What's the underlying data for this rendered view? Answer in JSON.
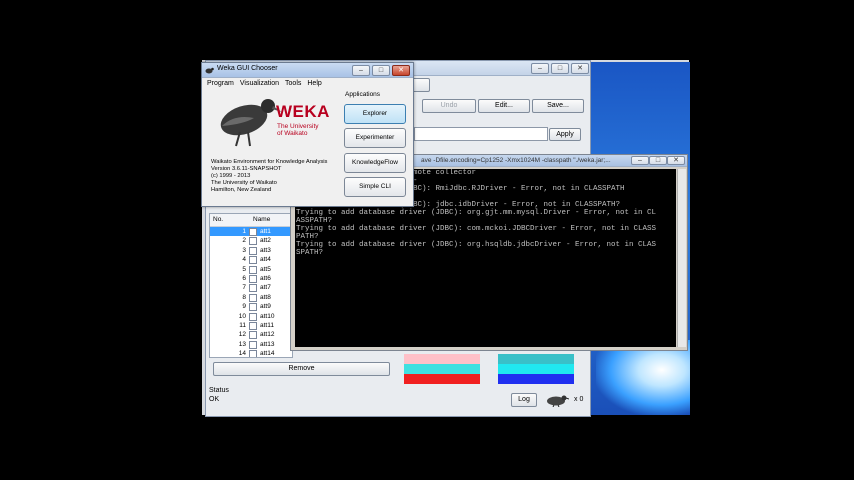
{
  "explorer": {
    "undo": "Undo",
    "edit": "Edit...",
    "save": "Save...",
    "apply": "Apply",
    "table_headers": {
      "no": "No.",
      "name": "Name"
    },
    "attributes": [
      {
        "no": "1",
        "name": "att1"
      },
      {
        "no": "2",
        "name": "att2"
      },
      {
        "no": "3",
        "name": "att3"
      },
      {
        "no": "4",
        "name": "att4"
      },
      {
        "no": "5",
        "name": "att5"
      },
      {
        "no": "6",
        "name": "att6"
      },
      {
        "no": "7",
        "name": "att7"
      },
      {
        "no": "8",
        "name": "att8"
      },
      {
        "no": "9",
        "name": "att9"
      },
      {
        "no": "10",
        "name": "att10"
      },
      {
        "no": "11",
        "name": "att11"
      },
      {
        "no": "12",
        "name": "att12"
      },
      {
        "no": "13",
        "name": "att13"
      },
      {
        "no": "14",
        "name": "att14"
      }
    ],
    "remove": "Remove",
    "status_label": "Status",
    "status_value": "OK",
    "log": "Log",
    "task_count": "x 0"
  },
  "chooser": {
    "title": "Weka GUI Chooser",
    "menu": [
      "Program",
      "Visualization",
      "Tools",
      "Help"
    ],
    "logo_word": "WEKA",
    "logo_sub1": "The University",
    "logo_sub2": "of Waikato",
    "info": [
      "Waikato Environment for Knowledge Analysis",
      "Version 3.6.11-SNAPSHOT",
      "(c) 1999 - 2013",
      "The University of Waikato",
      "Hamilton, New Zealand"
    ],
    "applications_label": "Applications",
    "buttons": [
      "Explorer",
      "Experimenter",
      "KnowledgeFlow",
      "Simple CLI"
    ]
  },
  "console": {
    "title": "ave -Dfile.encoding=Cp1252 -Xmx1024M -classpath \"./weka.jar;...",
    "lines": [
      "                32trace remote collector",
      "                        ---",
      "                driver (JDBC): RmiJdbc.RJDriver - Error, not in CLASSPATH",
      "                ",
      "                driver (JDBC): jdbc.idbDriver - Error, not in CLASSPATH?",
      "Trying to add database driver (JDBC): org.gjt.mm.mysql.Driver - Error, not in CL",
      "ASSPATH?",
      "Trying to add database driver (JDBC): com.mckoi.JDBCDriver - Error, not in CLASS",
      "PATH?",
      "Trying to add database driver (JDBC): org.hsqldb.jdbcDriver - Error, not in CLAS",
      "SPATH?"
    ]
  },
  "colors": {
    "selection": "#3399ff",
    "console_bg": "#000000",
    "console_fg": "#c0c0c0"
  }
}
